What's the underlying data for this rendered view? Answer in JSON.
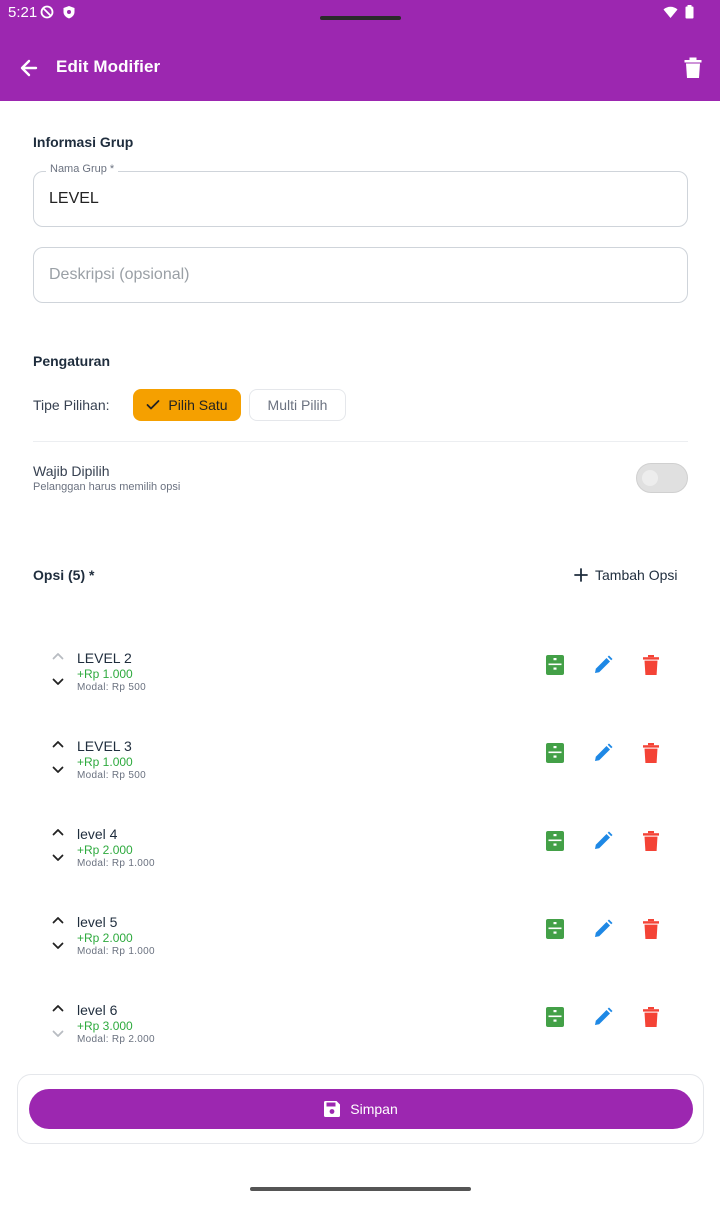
{
  "status_bar": {
    "time": "5:21"
  },
  "app_bar": {
    "title": "Edit Modifier"
  },
  "group_info": {
    "section_title": "Informasi Grup",
    "name_label": "Nama Grup *",
    "name_value": "LEVEL",
    "description_placeholder": "Deskripsi (opsional)"
  },
  "settings": {
    "section_title": "Pengaturan",
    "choice_type_label": "Tipe Pilihan:",
    "single_choice_label": "Pilih Satu",
    "multi_choice_label": "Multi Pilih",
    "required_title": "Wajib Dipilih",
    "required_subtitle": "Pelanggan harus memilih opsi",
    "required_enabled": false
  },
  "options": {
    "section_title": "Opsi (5) *",
    "add_label": "Tambah Opsi",
    "items": [
      {
        "name": "LEVEL 2",
        "price": "+Rp 1.000",
        "cost": "Modal: Rp 500"
      },
      {
        "name": "LEVEL 3",
        "price": "+Rp 1.000",
        "cost": "Modal: Rp 500"
      },
      {
        "name": "level 4",
        "price": "+Rp 2.000",
        "cost": "Modal: Rp 1.000"
      },
      {
        "name": "level 5",
        "price": "+Rp 2.000",
        "cost": "Modal: Rp 1.000"
      },
      {
        "name": "level 6",
        "price": "+Rp 3.000",
        "cost": "Modal: Rp 2.000"
      }
    ]
  },
  "footer": {
    "save_label": "Simpan"
  },
  "colors": {
    "primary": "#9c27b0",
    "accent": "#f5a000",
    "price_green": "#2eaa3e",
    "stock_green": "#43a047",
    "edit_blue": "#1e88e5",
    "delete_red": "#f44336"
  }
}
